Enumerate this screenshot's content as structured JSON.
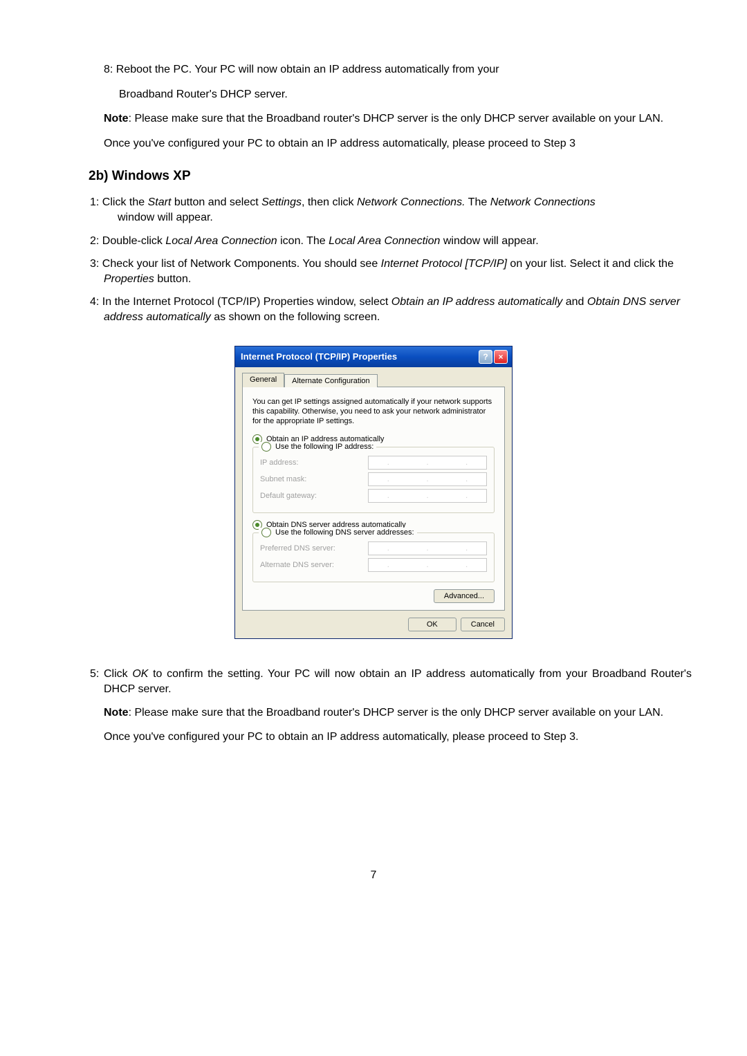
{
  "step8": {
    "line1": "8: Reboot the PC. Your PC will now obtain an IP address automatically from your",
    "line2": "Broadband Router's DHCP server."
  },
  "note1": {
    "label": "Note",
    "text": ": Please make sure that the Broadband router's DHCP server is the only DHCP server available on your LAN."
  },
  "once1": "Once you've configured your PC to obtain an IP address automatically, please proceed to Step 3",
  "section_title": "2b) Windows XP",
  "steps": {
    "s1a": "1: Click the ",
    "s1b": "Start",
    "s1c": " button and select ",
    "s1d": "Settings",
    "s1e": ", then click ",
    "s1f": "Network Connections.",
    "s1g": " The ",
    "s1h": "Network Connections",
    "s1i": "  window will appear.",
    "s2a": "2: Double-click ",
    "s2b": "Local Area Connection",
    "s2c": " icon. The ",
    "s2d": "Local Area  Connection",
    "s2e": " window will appear.",
    "s3a": "3: Check your list of Network Components. You should see ",
    "s3b": "Internet Protocol [TCP/IP]",
    "s3c": " on your list. Select it and click the ",
    "s3d": "Properties",
    "s3e": " button.",
    "s4a": "4: In the Internet Protocol (TCP/IP) Properties window, select ",
    "s4b": "Obtain an IP address automatically",
    "s4c": " and ",
    "s4d": "Obtain DNS server address automatically",
    "s4e": " as shown on the following screen."
  },
  "dialog": {
    "title": "Internet Protocol (TCP/IP) Properties",
    "tab_general": "General",
    "tab_alt": "Alternate Configuration",
    "help_text": "You can get IP settings assigned automatically if your network supports this capability. Otherwise, you need to ask your network administrator for the appropriate IP settings.",
    "radio_obtain_ip": "Obtain an IP address automatically",
    "radio_use_ip": "Use the following IP address:",
    "ip_address_label": "IP address:",
    "subnet_label": "Subnet mask:",
    "gateway_label": "Default gateway:",
    "radio_obtain_dns": "Obtain DNS server address automatically",
    "radio_use_dns": "Use the following DNS server addresses:",
    "pref_dns_label": "Preferred DNS server:",
    "alt_dns_label": "Alternate DNS server:",
    "advanced_btn": "Advanced...",
    "ok_btn": "OK",
    "cancel_btn": "Cancel"
  },
  "step5": {
    "a": "5: Click ",
    "b": "OK",
    "c": " to confirm the setting. Your PC will now obtain an IP address automatically from your Broadband Router's DHCP server."
  },
  "note2": {
    "label": "Note",
    "text": ": Please make sure that the Broadband router's DHCP server is the only DHCP server available on your LAN."
  },
  "once2": "Once you've configured your PC to obtain an IP address automatically, please proceed to Step 3.",
  "page_num": "7"
}
